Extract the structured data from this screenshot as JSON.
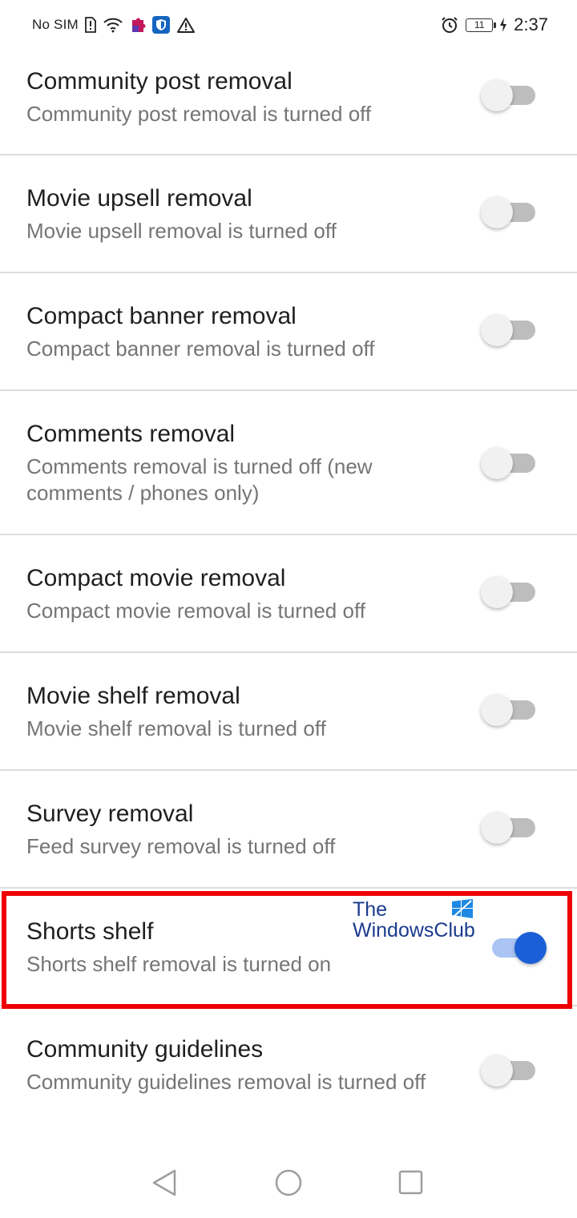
{
  "status_bar": {
    "carrier": "No SIM",
    "battery_level": "11",
    "time": "2:37",
    "icons": [
      "sim-alert-icon",
      "wifi-icon",
      "puzzle-app-icon",
      "shield-app-icon",
      "warning-icon",
      "alarm-icon",
      "charging-icon"
    ]
  },
  "settings": [
    {
      "title": "Community post removal",
      "summary": "Community post removal is turned off",
      "enabled": false
    },
    {
      "title": "Movie upsell removal",
      "summary": "Movie upsell removal is turned off",
      "enabled": false
    },
    {
      "title": "Compact banner removal",
      "summary": "Compact banner removal is turned off",
      "enabled": false
    },
    {
      "title": "Comments removal",
      "summary": "Comments removal is turned off (new comments / phones only)",
      "enabled": false
    },
    {
      "title": "Compact movie removal",
      "summary": "Compact movie removal is turned off",
      "enabled": false
    },
    {
      "title": "Movie shelf removal",
      "summary": "Movie shelf removal is turned off",
      "enabled": false
    },
    {
      "title": "Survey removal",
      "summary": "Feed survey removal is turned off",
      "enabled": false
    },
    {
      "title": "Shorts shelf",
      "summary": "Shorts shelf removal is turned on",
      "enabled": true
    },
    {
      "title": "Community guidelines",
      "summary": "Community guidelines removal is turned off",
      "enabled": false
    }
  ],
  "watermark": {
    "line1": "The",
    "line2": "WindowsClub"
  },
  "colors": {
    "accent": "#1a5fd6",
    "accent_track": "#aac4f4",
    "highlight": "#ee0000",
    "title_text": "#1f1f1f",
    "summary_text": "#757575",
    "divider": "#dcdcdc"
  },
  "nav_bar": {
    "icons": [
      "back-icon",
      "home-icon",
      "recents-icon"
    ]
  }
}
